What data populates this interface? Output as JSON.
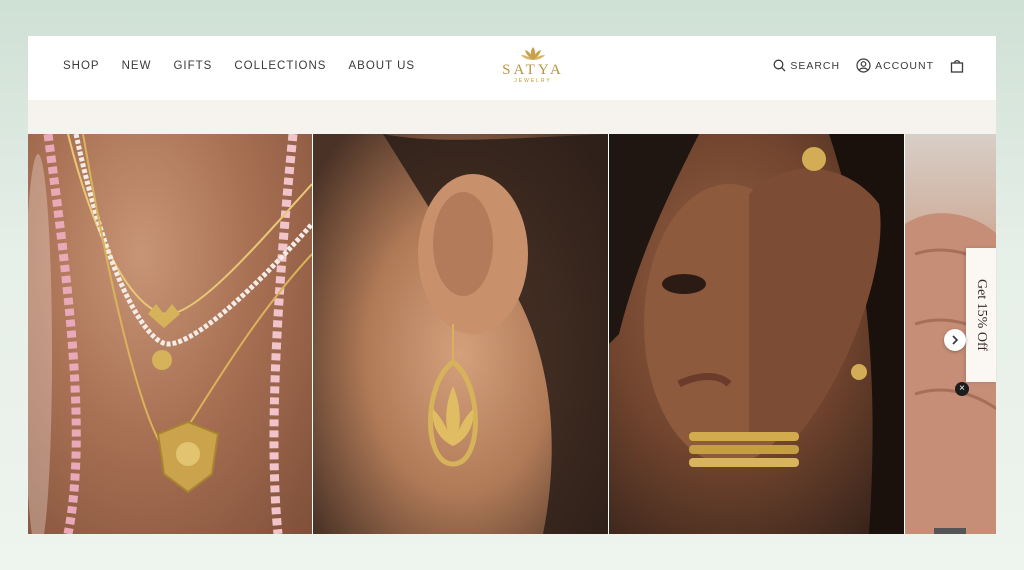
{
  "nav": {
    "items": [
      {
        "label": "SHOP"
      },
      {
        "label": "NEW"
      },
      {
        "label": "GIFTS"
      },
      {
        "label": "COLLECTIONS"
      },
      {
        "label": "ABOUT US"
      }
    ]
  },
  "brand": {
    "name": "SATYA",
    "tagline": "JEWELRY",
    "color": "#b8963e",
    "icon": "lotus-icon"
  },
  "tools": {
    "search_label": "SEARCH",
    "account_label": "ACCOUNT",
    "icons": [
      "search-icon",
      "account-icon",
      "cart-icon"
    ]
  },
  "promo": {
    "tab_label": "Get 15% Off",
    "close_label": "×"
  },
  "gallery": {
    "images": [
      "necklaces-photo",
      "earring-photo",
      "bracelet-ring-photo",
      "hand-ring-photo"
    ]
  }
}
